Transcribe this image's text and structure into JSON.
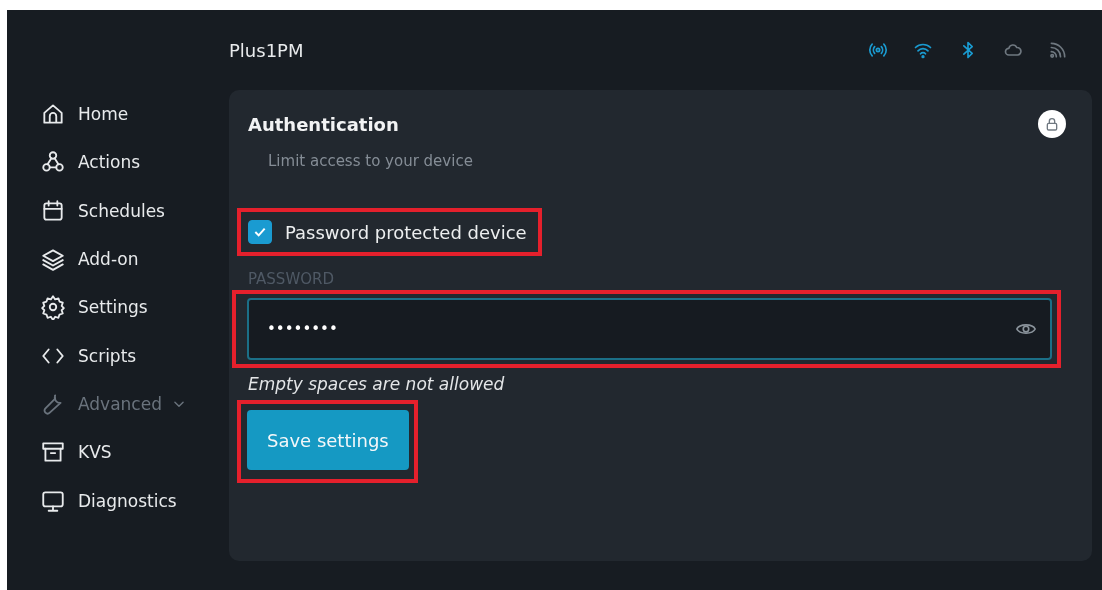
{
  "header": {
    "title": "Plus1PM"
  },
  "status_icons": [
    {
      "kind": "signal",
      "on": true
    },
    {
      "kind": "wifi",
      "on": true
    },
    {
      "kind": "bluetooth",
      "on": true
    },
    {
      "kind": "cloud",
      "on": false
    },
    {
      "kind": "feed",
      "on": false
    }
  ],
  "sidebar": {
    "items": [
      {
        "kind": "home",
        "label": "Home",
        "disabled": false,
        "expandable": false
      },
      {
        "kind": "actions",
        "label": "Actions",
        "disabled": false,
        "expandable": false
      },
      {
        "kind": "calendar",
        "label": "Schedules",
        "disabled": false,
        "expandable": false
      },
      {
        "kind": "layers",
        "label": "Add-on",
        "disabled": false,
        "expandable": false
      },
      {
        "kind": "gear",
        "label": "Settings",
        "disabled": false,
        "expandable": false
      },
      {
        "kind": "code",
        "label": "Scripts",
        "disabled": false,
        "expandable": false
      },
      {
        "kind": "wrench",
        "label": "Advanced",
        "disabled": true,
        "expandable": true
      },
      {
        "kind": "archive",
        "label": "KVS",
        "disabled": false,
        "expandable": false
      },
      {
        "kind": "monitor",
        "label": "Diagnostics",
        "disabled": false,
        "expandable": false
      }
    ]
  },
  "card": {
    "title": "Authentication",
    "subtitle": "Limit access to your device",
    "checkbox": {
      "label": "Password protected device",
      "checked": true,
      "highlighted": true
    },
    "password": {
      "label": "PASSWORD",
      "value": "••••••••",
      "focused": true,
      "highlighted": true
    },
    "hint": "Empty spaces are not allowed",
    "save_button": {
      "label": "Save settings",
      "highlighted": true
    }
  }
}
